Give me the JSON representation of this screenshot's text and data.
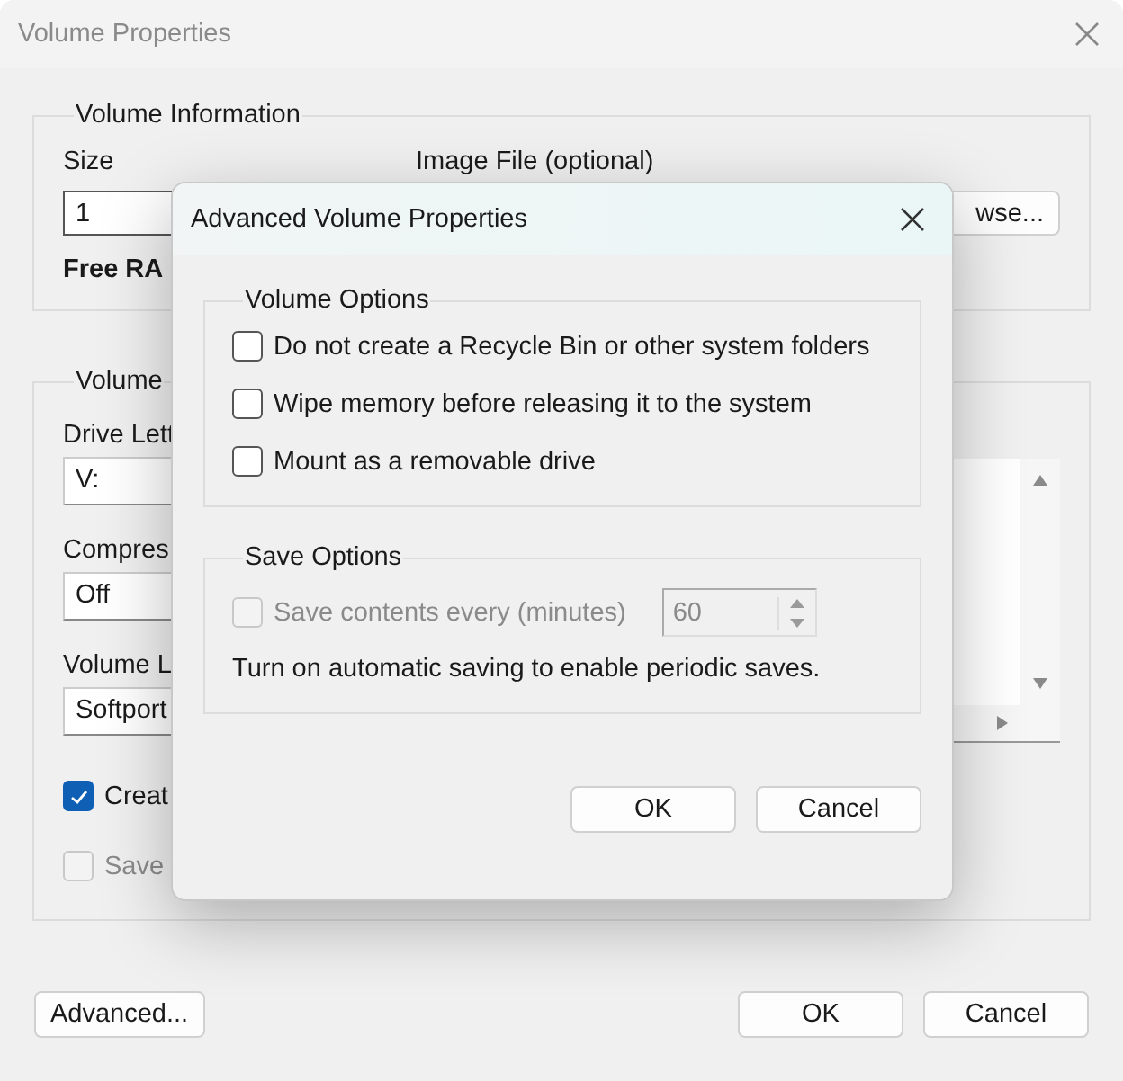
{
  "window": {
    "title": "Volume Properties"
  },
  "volume_information": {
    "legend": "Volume Information",
    "size_label": "Size",
    "size_value": "1",
    "image_file_label": "Image File (optional)",
    "browse_button": "wse...",
    "free_ram_label": "Free RA"
  },
  "volume_config": {
    "legend": "Volume",
    "fields": [
      {
        "label": "Drive Lett",
        "value": "V:"
      },
      {
        "label": "Compres",
        "value": "Off"
      },
      {
        "label": "Volume L",
        "value": "Softport"
      }
    ],
    "checkboxes": [
      {
        "label": "Creat",
        "checked": true,
        "disabled": false
      },
      {
        "label": "Save",
        "checked": false,
        "disabled": true
      }
    ]
  },
  "left_buttons": [
    "Advanced..."
  ],
  "right_buttons": [
    "OK",
    "Cancel"
  ],
  "dialog": {
    "title": "Advanced Volume Properties",
    "volume_options": {
      "legend": "Volume Options",
      "checkboxes": [
        {
          "label": "Do not create a Recycle Bin or other system folders",
          "checked": false,
          "disabled": false
        },
        {
          "label": "Wipe memory before releasing it to the system",
          "checked": false,
          "disabled": false
        },
        {
          "label": "Mount as a removable drive",
          "checked": false,
          "disabled": false
        }
      ]
    },
    "save_options": {
      "legend": "Save Options",
      "checkbox": {
        "label": "Save contents every (minutes)",
        "checked": false,
        "disabled": true
      },
      "spinner": {
        "value": "60",
        "disabled": true
      },
      "note": "Turn on automatic saving to enable periodic saves."
    },
    "buttons": [
      "OK",
      "Cancel"
    ]
  }
}
